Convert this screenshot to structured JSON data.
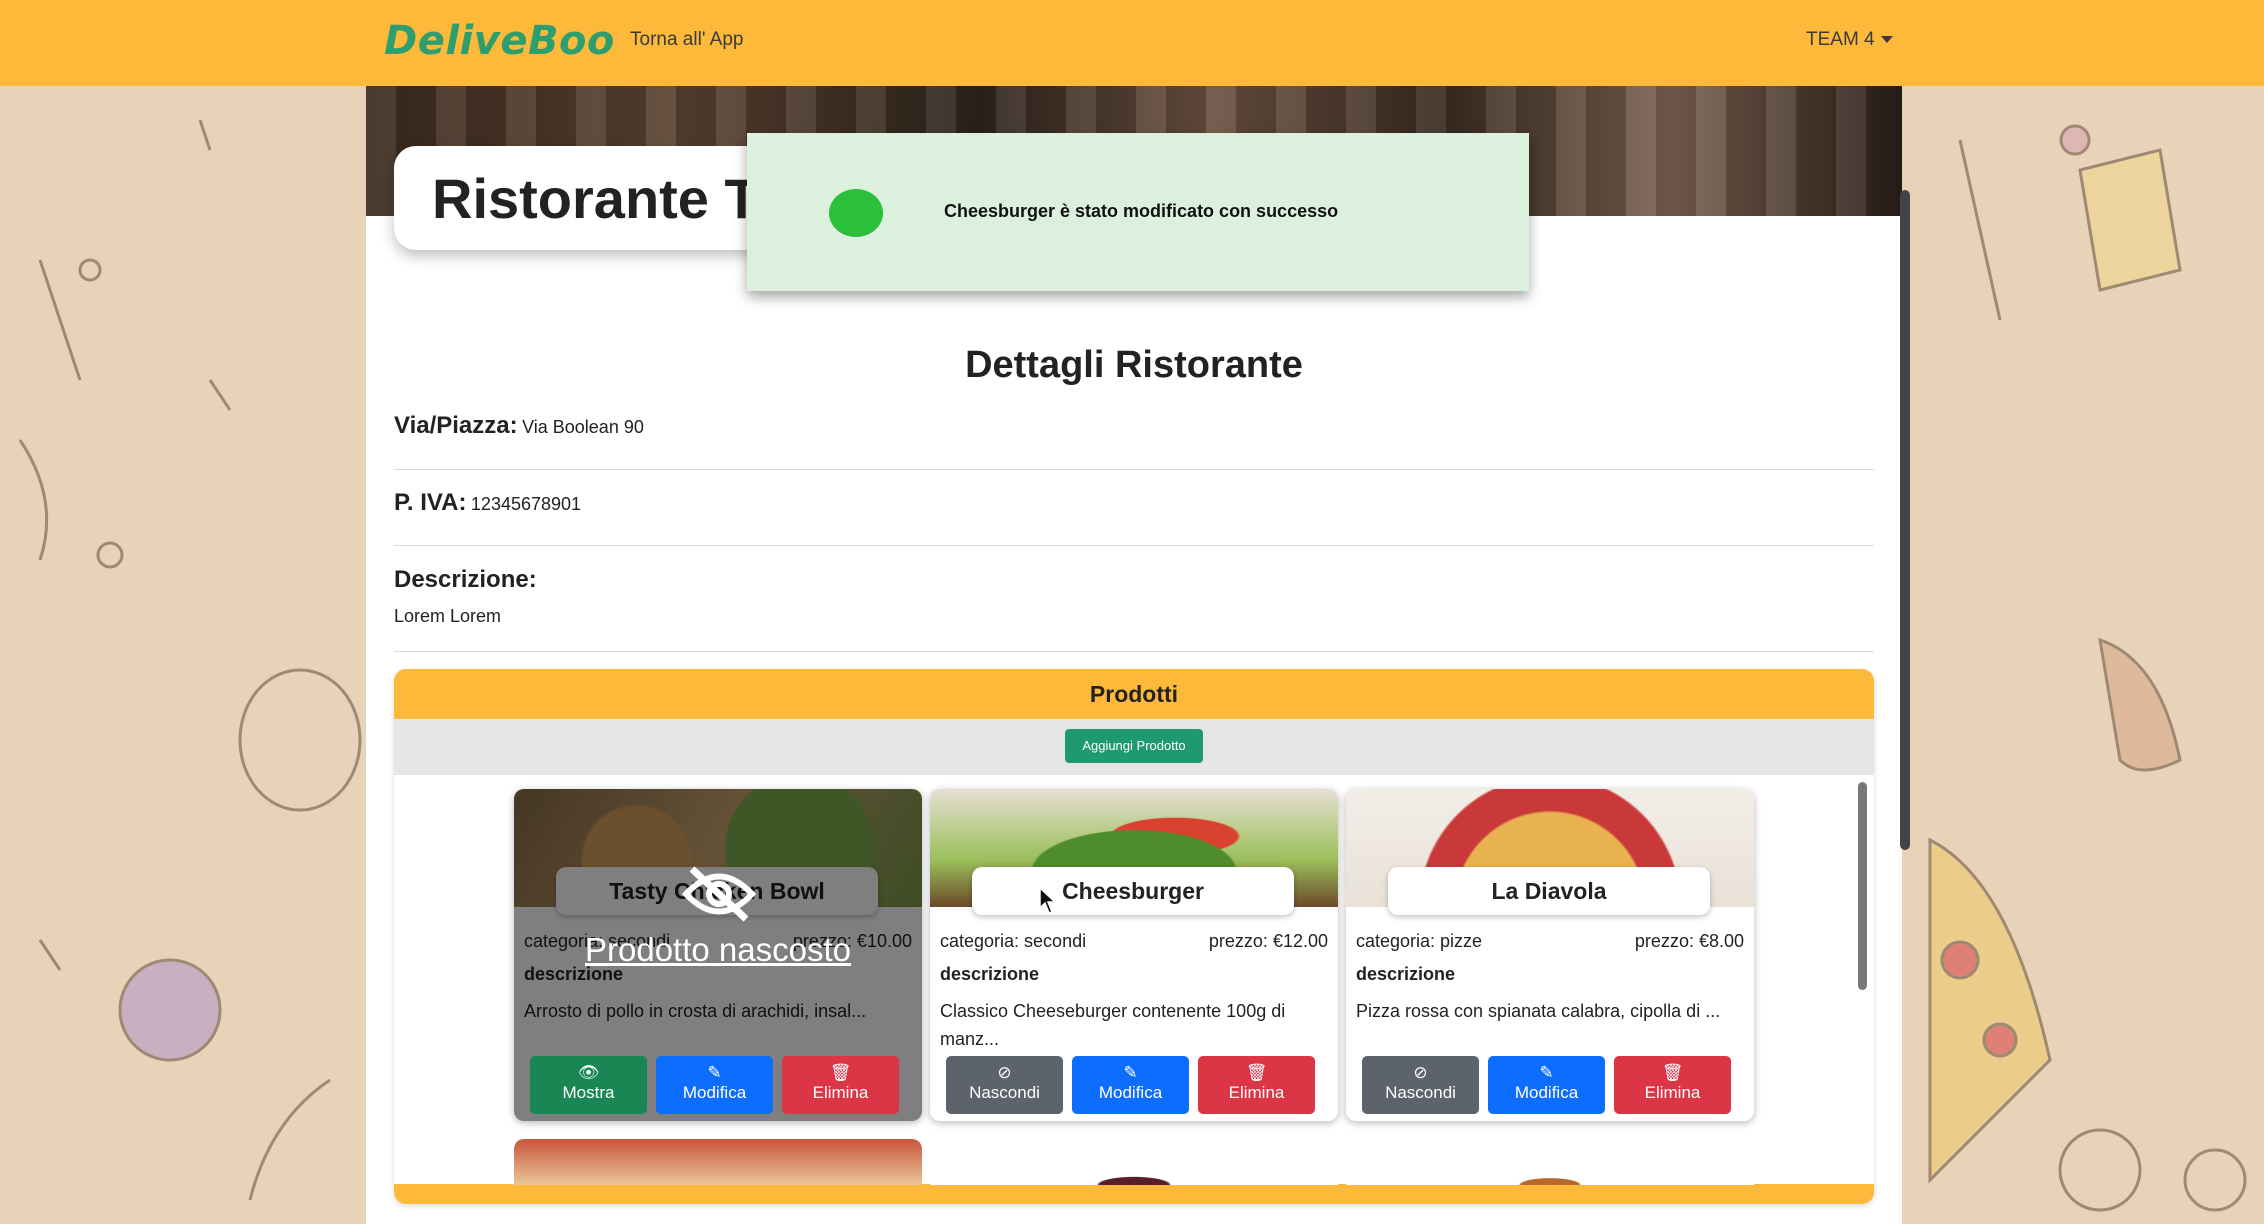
{
  "navbar": {
    "logo": "DeliveBoo",
    "back_link": "Torna all' App",
    "user_menu": "TEAM 4"
  },
  "restaurant": {
    "title": "Ristorante T"
  },
  "toast": {
    "message": "Cheesburger è stato modificato con successo",
    "status_color": "#2bbf3a"
  },
  "details": {
    "heading": "Dettagli Ristorante",
    "address_label": "Via/Piazza:",
    "address_value": "Via Boolean 90",
    "vat_label": "P. IVA:",
    "vat_value": "12345678901",
    "description_label": "Descrizione:",
    "description_value": "Lorem Lorem"
  },
  "products": {
    "heading": "Prodotti",
    "add_button": "Aggiungi Prodotto",
    "items": [
      {
        "name": "Tasty Chicken Bowl",
        "category": "categoria: secondi",
        "price": "prezzo: €10.00",
        "desc_label": "descrizione",
        "description": "Arrosto di pollo in crosta di arachidi, insal...",
        "hidden": true,
        "hidden_text": "Prodotto nascosto",
        "toggle_label": "Mostra",
        "edit_label": "Modifica",
        "delete_label": "Elimina"
      },
      {
        "name": "Cheesburger",
        "category": "categoria: secondi",
        "price": "prezzo: €12.00",
        "desc_label": "descrizione",
        "description": "Classico Cheeseburger contenente 100g di manz...",
        "hidden": false,
        "toggle_label": "Nascondi",
        "edit_label": "Modifica",
        "delete_label": "Elimina"
      },
      {
        "name": "La Diavola",
        "category": "categoria: pizze",
        "price": "prezzo: €8.00",
        "desc_label": "descrizione",
        "description": "Pizza rossa con spianata calabra, cipolla di ...",
        "hidden": false,
        "toggle_label": "Nascondi",
        "edit_label": "Modifica",
        "delete_label": "Elimina"
      }
    ]
  },
  "colors": {
    "brand": "#fcb93a",
    "logo": "#2f9e6e",
    "show": "#198754",
    "edit": "#0d6efd",
    "delete": "#dc3545",
    "hide": "#5c636a"
  }
}
